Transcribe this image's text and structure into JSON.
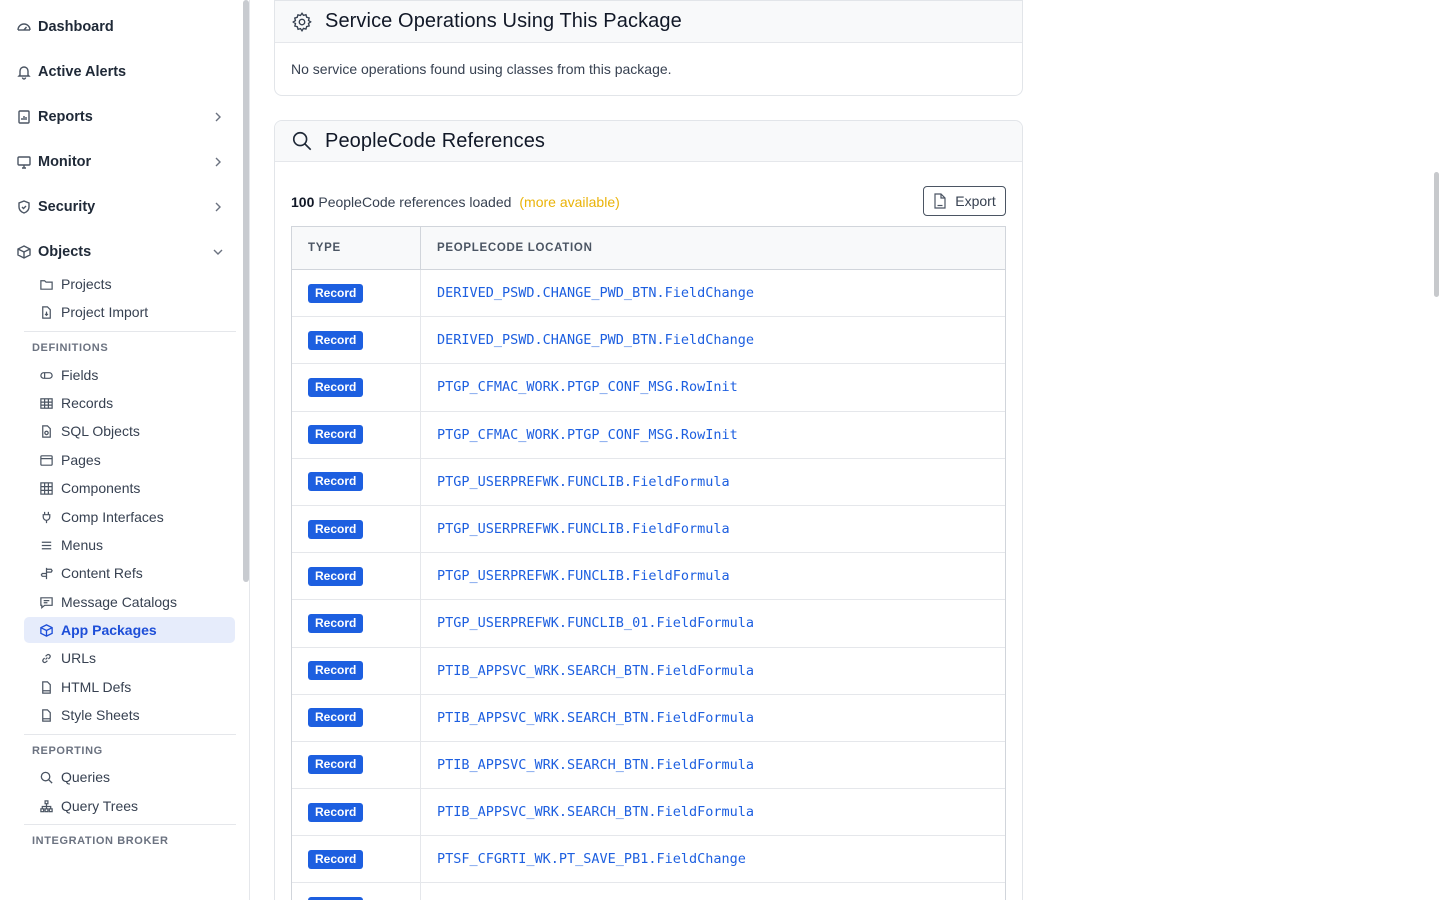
{
  "sidebar": {
    "top_items": [
      {
        "label": "Dashboard",
        "icon": "dashboard-icon"
      },
      {
        "label": "Active Alerts",
        "icon": "bell-icon"
      },
      {
        "label": "Reports",
        "icon": "report-icon"
      },
      {
        "label": "Monitor",
        "icon": "monitor-icon"
      },
      {
        "label": "Security",
        "icon": "shield-icon"
      },
      {
        "label": "Objects",
        "icon": "cube-icon"
      }
    ],
    "objects_items": [
      {
        "label": "Projects",
        "icon": "folder-icon"
      },
      {
        "label": "Project Import",
        "icon": "file-import-icon"
      }
    ],
    "definitions_label": "DEFINITIONS",
    "definitions": [
      {
        "label": "Fields",
        "icon": "field-icon"
      },
      {
        "label": "Records",
        "icon": "table-icon"
      },
      {
        "label": "SQL Objects",
        "icon": "sql-file-icon"
      },
      {
        "label": "Pages",
        "icon": "page-icon"
      },
      {
        "label": "Components",
        "icon": "grid-icon"
      },
      {
        "label": "Comp Interfaces",
        "icon": "plug-icon"
      },
      {
        "label": "Menus",
        "icon": "menu-icon"
      },
      {
        "label": "Content Refs",
        "icon": "signpost-icon"
      },
      {
        "label": "Message Catalogs",
        "icon": "message-icon"
      },
      {
        "label": "App Packages",
        "icon": "package-icon",
        "active": true
      },
      {
        "label": "URLs",
        "icon": "link-icon"
      },
      {
        "label": "HTML Defs",
        "icon": "html-file-icon"
      },
      {
        "label": "Style Sheets",
        "icon": "css-file-icon"
      }
    ],
    "reporting_label": "REPORTING",
    "reporting": [
      {
        "label": "Queries",
        "icon": "search-icon"
      },
      {
        "label": "Query Trees",
        "icon": "tree-icon"
      }
    ],
    "integration_label": "INTEGRATION BROKER"
  },
  "service_ops": {
    "title": "Service Operations Using This Package",
    "empty_text": "No service operations found using classes from this package."
  },
  "peoplecode": {
    "title": "PeopleCode References",
    "count": "100",
    "count_suffix": "PeopleCode references loaded",
    "more_text": "(more available)",
    "export_label": "Export",
    "columns": [
      "TYPE",
      "PEOPLECODE LOCATION"
    ],
    "rows": [
      {
        "type": "Record",
        "location": "DERIVED_PSWD.CHANGE_PWD_BTN.FieldChange"
      },
      {
        "type": "Record",
        "location": "DERIVED_PSWD.CHANGE_PWD_BTN.FieldChange"
      },
      {
        "type": "Record",
        "location": "PTGP_CFMAC_WORK.PTGP_CONF_MSG.RowInit"
      },
      {
        "type": "Record",
        "location": "PTGP_CFMAC_WORK.PTGP_CONF_MSG.RowInit"
      },
      {
        "type": "Record",
        "location": "PTGP_USERPREFWK.FUNCLIB.FieldFormula"
      },
      {
        "type": "Record",
        "location": "PTGP_USERPREFWK.FUNCLIB.FieldFormula"
      },
      {
        "type": "Record",
        "location": "PTGP_USERPREFWK.FUNCLIB.FieldFormula"
      },
      {
        "type": "Record",
        "location": "PTGP_USERPREFWK.FUNCLIB_01.FieldFormula"
      },
      {
        "type": "Record",
        "location": "PTIB_APPSVC_WRK.SEARCH_BTN.FieldFormula"
      },
      {
        "type": "Record",
        "location": "PTIB_APPSVC_WRK.SEARCH_BTN.FieldFormula"
      },
      {
        "type": "Record",
        "location": "PTIB_APPSVC_WRK.SEARCH_BTN.FieldFormula"
      },
      {
        "type": "Record",
        "location": "PTIB_APPSVC_WRK.SEARCH_BTN.FieldFormula"
      },
      {
        "type": "Record",
        "location": "PTSF_CFGRTI_WK.PT_SAVE_PB1.FieldChange"
      },
      {
        "type": "Record",
        "location": ""
      }
    ]
  },
  "colors": {
    "accent": "#1d5fe0",
    "active_bg": "#e6ecfb",
    "more_available": "#eab308"
  }
}
